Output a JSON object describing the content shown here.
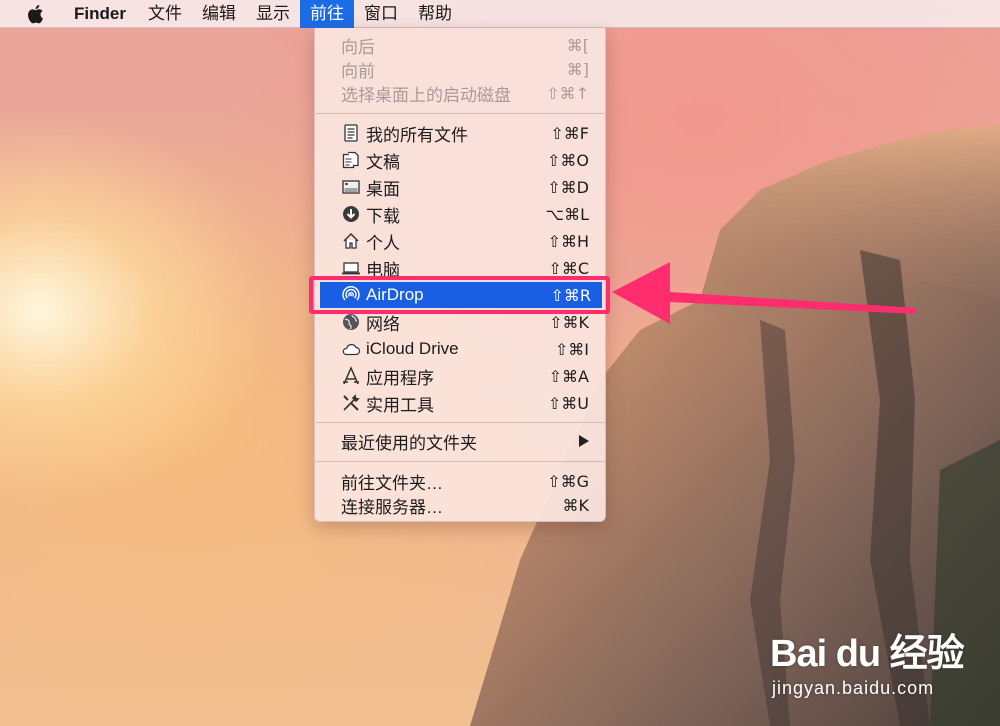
{
  "menubar": {
    "app_name": "Finder",
    "items": [
      "文件",
      "编辑",
      "显示",
      "前往",
      "窗口",
      "帮助"
    ],
    "active": "前往"
  },
  "go_menu": {
    "back": {
      "label": "向后",
      "shortcut": "⌘["
    },
    "forward": {
      "label": "向前",
      "shortcut": "⌘]"
    },
    "startup_disk": {
      "label": "选择桌面上的启动磁盘",
      "shortcut": "⇧⌘↑"
    },
    "all_files": {
      "label": "我的所有文件",
      "shortcut": "⇧⌘F",
      "icon": "all-files-icon"
    },
    "documents": {
      "label": "文稿",
      "shortcut": "⇧⌘O",
      "icon": "documents-icon"
    },
    "desktop": {
      "label": "桌面",
      "shortcut": "⇧⌘D",
      "icon": "desktop-icon"
    },
    "downloads": {
      "label": "下载",
      "shortcut": "⌥⌘L",
      "icon": "downloads-icon"
    },
    "home": {
      "label": "个人",
      "shortcut": "⇧⌘H",
      "icon": "home-icon"
    },
    "computer": {
      "label": "电脑",
      "shortcut": "⇧⌘C",
      "icon": "laptop-icon"
    },
    "airdrop": {
      "label": "AirDrop",
      "shortcut": "⇧⌘R",
      "icon": "airdrop-icon"
    },
    "network": {
      "label": "网络",
      "shortcut": "⇧⌘K",
      "icon": "globe-icon"
    },
    "icloud": {
      "label": "iCloud Drive",
      "shortcut": "⇧⌘I",
      "icon": "cloud-icon"
    },
    "applications": {
      "label": "应用程序",
      "shortcut": "⇧⌘A",
      "icon": "applications-icon"
    },
    "utilities": {
      "label": "实用工具",
      "shortcut": "⇧⌘U",
      "icon": "utilities-icon"
    },
    "recent_folders": {
      "label": "最近使用的文件夹"
    },
    "go_to_folder": {
      "label": "前往文件夹…",
      "shortcut": "⇧⌘G"
    },
    "connect_server": {
      "label": "连接服务器…",
      "shortcut": "⌘K"
    }
  },
  "watermark": {
    "logo": "Bai du 经验",
    "url": "jingyan.baidu.com"
  },
  "colors": {
    "highlight": "#1a5fe3",
    "annotation": "#ff2d6e",
    "menubar_active": "#1c6ce6"
  }
}
